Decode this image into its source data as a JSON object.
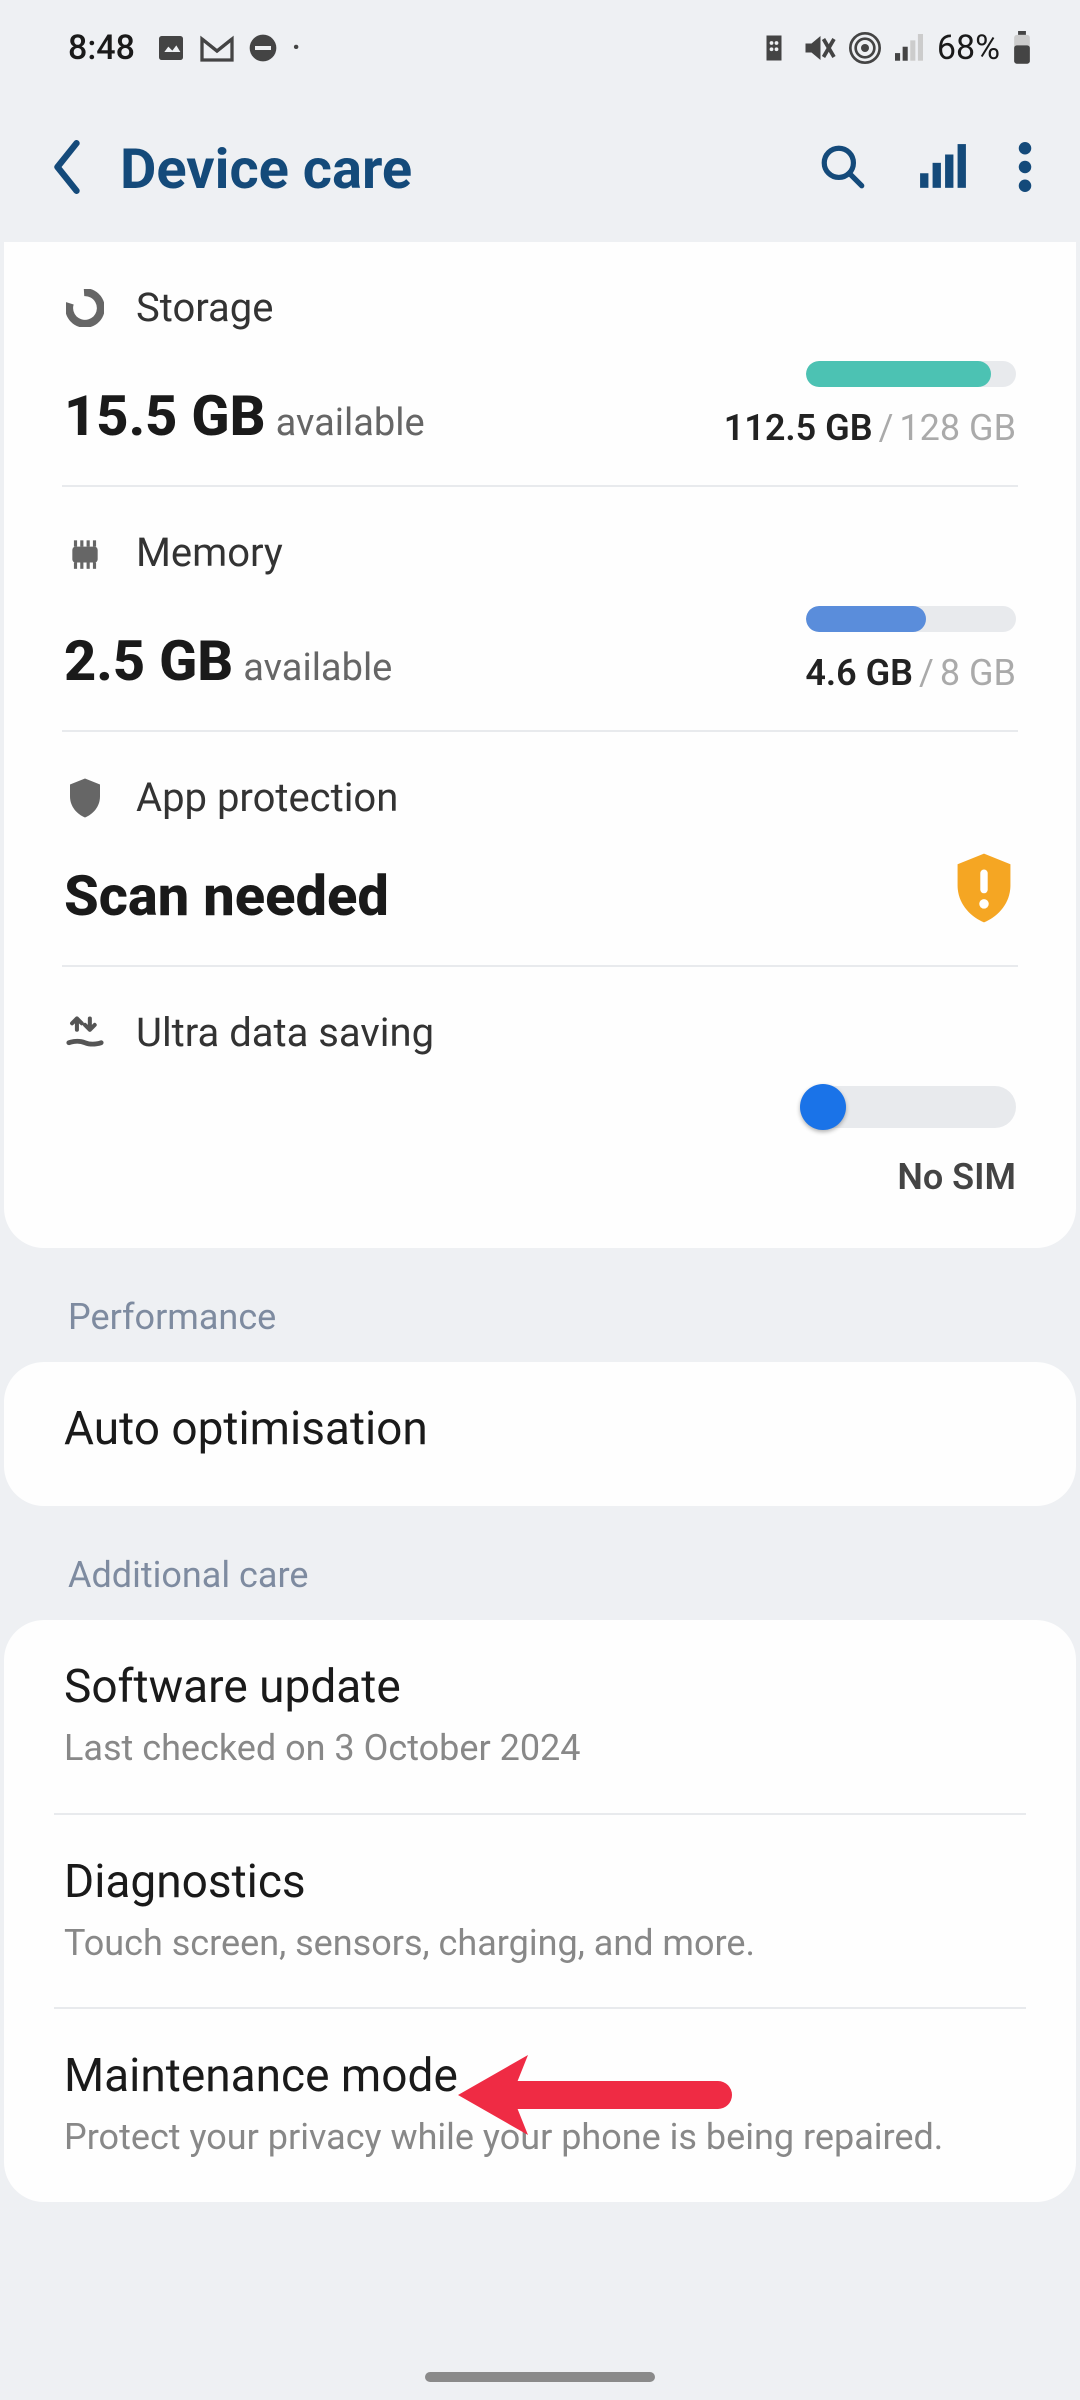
{
  "status": {
    "time": "8:48",
    "battery": "68%"
  },
  "header": {
    "title": "Device care"
  },
  "storage": {
    "label": "Storage",
    "value": "15.5 GB",
    "suffix": "available",
    "used": "112.5 GB",
    "total": "128 GB",
    "fill_percent": 88,
    "fill_color": "#4cc2b3"
  },
  "memory": {
    "label": "Memory",
    "value": "2.5 GB",
    "suffix": "available",
    "used": "4.6 GB",
    "total": "8 GB",
    "fill_percent": 57,
    "fill_color": "#5a8ddb"
  },
  "protection": {
    "label": "App protection",
    "status": "Scan needed"
  },
  "ultra": {
    "label": "Ultra data saving",
    "nosim": "No SIM"
  },
  "sections": {
    "performance": "Performance",
    "additional": "Additional care"
  },
  "auto_opt": {
    "title": "Auto optimisation"
  },
  "software": {
    "title": "Software update",
    "sub": "Last checked on 3 October 2024"
  },
  "diagnostics": {
    "title": "Diagnostics",
    "sub": "Touch screen, sensors, charging, and more."
  },
  "maintenance": {
    "title": "Maintenance mode",
    "sub": "Protect your privacy while your phone is being repaired."
  }
}
